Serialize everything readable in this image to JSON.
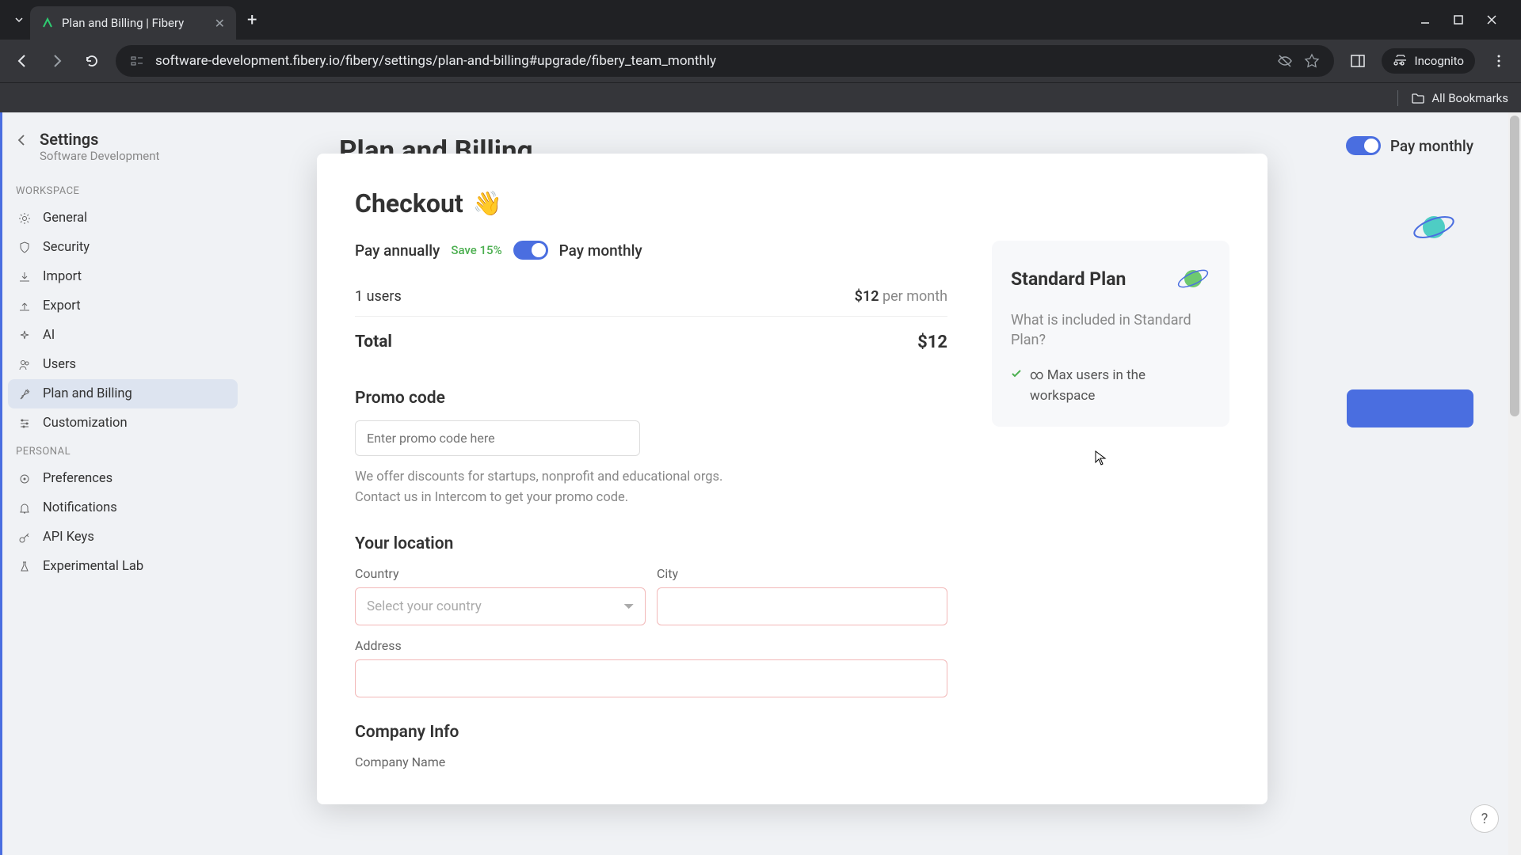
{
  "browser": {
    "tab_title": "Plan and Billing | Fibery",
    "url": "software-development.fibery.io/fibery/settings/plan-and-billing#upgrade/fibery_team_monthly",
    "incognito": "Incognito",
    "all_bookmarks": "All Bookmarks"
  },
  "sidebar": {
    "title": "Settings",
    "subtitle": "Software Development",
    "workspace_label": "WORKSPACE",
    "personal_label": "PERSONAL",
    "items_workspace": [
      {
        "label": "General",
        "icon": "gear"
      },
      {
        "label": "Security",
        "icon": "shield"
      },
      {
        "label": "Import",
        "icon": "download"
      },
      {
        "label": "Export",
        "icon": "upload"
      },
      {
        "label": "AI",
        "icon": "sparkle"
      },
      {
        "label": "Users",
        "icon": "users"
      },
      {
        "label": "Plan and Billing",
        "icon": "rocket",
        "active": true
      },
      {
        "label": "Customization",
        "icon": "sliders"
      }
    ],
    "items_personal": [
      {
        "label": "Preferences",
        "icon": "pref"
      },
      {
        "label": "Notifications",
        "icon": "bell"
      },
      {
        "label": "API Keys",
        "icon": "key"
      },
      {
        "label": "Experimental Lab",
        "icon": "flask"
      }
    ]
  },
  "background": {
    "title": "Plan and Billing",
    "toggle_label": "Pay monthly"
  },
  "modal": {
    "title": "Checkout",
    "wave": "👋",
    "pay_annually": "Pay annually",
    "save_badge": "Save 15%",
    "pay_monthly": "Pay monthly",
    "users_label": "1 users",
    "price_per": "$12",
    "per_month": "per month",
    "total_label": "Total",
    "total_price": "$12",
    "promo_heading": "Promo code",
    "promo_placeholder": "Enter promo code here",
    "promo_hint1": "We offer discounts for startups, nonprofit and educational orgs.",
    "promo_hint2": "Contact us in Intercom to get your promo code.",
    "location_heading": "Your location",
    "country_label": "Country",
    "country_placeholder": "Select your country",
    "city_label": "City",
    "address_label": "Address",
    "company_heading": "Company Info",
    "company_name_label": "Company Name"
  },
  "plan_card": {
    "name": "Standard Plan",
    "desc": "What is included in Standard Plan?",
    "feature1": "∞  Max users in the workspace"
  },
  "help": "?"
}
